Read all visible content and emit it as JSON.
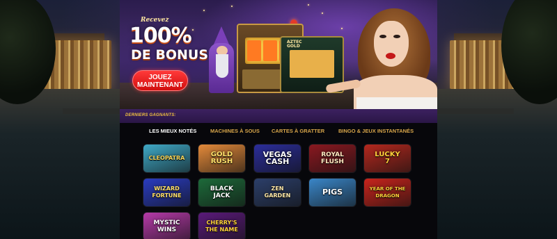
{
  "banner": {
    "kicker": "Recevez",
    "headline": "100%",
    "subheadline": "DE BONUS",
    "cta_line1": "JOUEZ",
    "cta_line2": "MAINTENANT",
    "machine_tag_line1": "AZTEC",
    "machine_tag_line2": "GOLD"
  },
  "winners": {
    "label": "DERNIERS GAGNANTS:"
  },
  "tabs": [
    {
      "label": "LES MIEUX NOTÉS",
      "active": true
    },
    {
      "label": "MACHINES À SOUS",
      "active": false
    },
    {
      "label": "CARTES À GRATTER",
      "active": false
    },
    {
      "label": "BINGO & JEUX INSTANTANÉS",
      "active": false
    }
  ],
  "games": [
    {
      "line1": "CLEOPATRA",
      "line2": "",
      "color": "#3fa9c7",
      "text_color": "#f3d35a"
    },
    {
      "line1": "GOLD",
      "line2": "RUSH",
      "color": "#e48a3a",
      "text_color": "#ffe06a"
    },
    {
      "line1": "VEGAS",
      "line2": "CASH",
      "color": "#2b2d9a",
      "text_color": "#ffffff"
    },
    {
      "line1": "ROYAL",
      "line2": "FLUSH",
      "color": "#8a1820",
      "text_color": "#ffe9c0"
    },
    {
      "line1": "LUCKY",
      "line2": "7",
      "color": "#b4281e",
      "text_color": "#ffd23a"
    },
    {
      "line1": "WIZARD",
      "line2": "FORTUNE",
      "color": "#2a3cc0",
      "text_color": "#ffe06a"
    },
    {
      "line1": "BLACK",
      "line2": "JACK",
      "color": "#1d6a3a",
      "text_color": "#ffffff"
    },
    {
      "line1": "ZEN",
      "line2": "GARDEN",
      "color": "#2c3f6a",
      "text_color": "#ffe9a8"
    },
    {
      "line1": "PIGS",
      "line2": "",
      "color": "#3a86c8",
      "text_color": "#ffffff"
    },
    {
      "line1": "YEAR OF THE",
      "line2": "DRAGON",
      "color": "#c8241c",
      "text_color": "#ffd23a"
    },
    {
      "line1": "MYSTIC",
      "line2": "WINS",
      "color": "#b53aa8",
      "text_color": "#ffffff"
    },
    {
      "line1": "CHERRY'S",
      "line2": "THE NAME",
      "color": "#5a1a7a",
      "text_color": "#ffd23a"
    }
  ],
  "colors": {
    "accent_gold": "#d7a54a",
    "cta_red": "#d10d0d",
    "winners_bar": "#3c2160"
  }
}
